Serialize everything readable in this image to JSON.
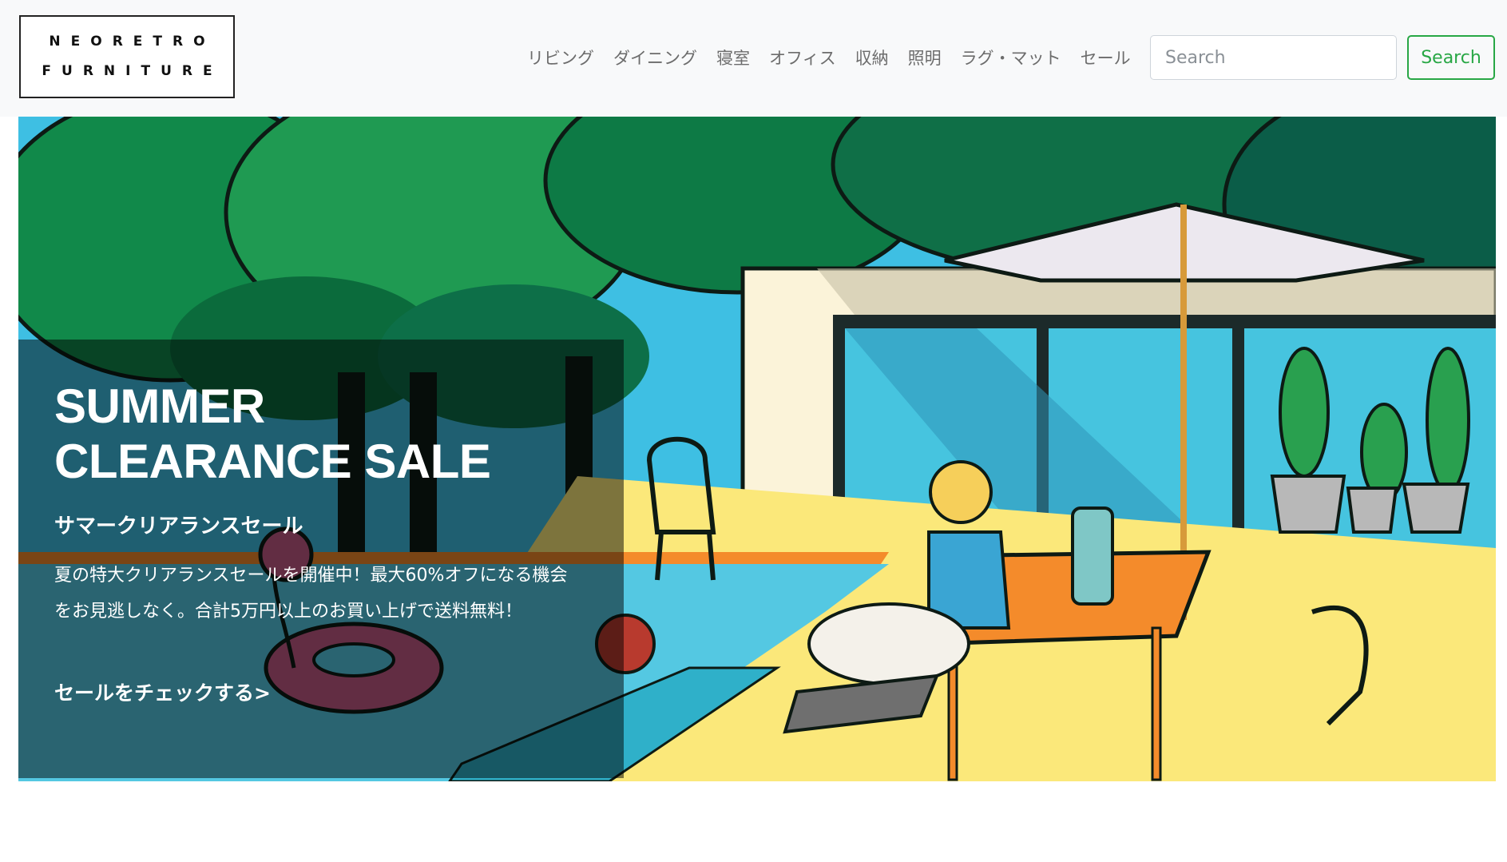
{
  "brand": {
    "line1": "NEORETRO",
    "line2": "FURNITURE"
  },
  "nav": {
    "items": [
      "リビング",
      "ダイニング",
      "寝室",
      "オフィス",
      "収納",
      "照明",
      "ラグ・マット",
      "セール"
    ]
  },
  "search": {
    "placeholder": "Search",
    "button_label": "Search"
  },
  "hero": {
    "title": "SUMMER\nCLEARANCE SALE",
    "subtitle": "サマークリアランスセール",
    "body": "夏の特大クリアランスセールを開催中！最大60%オフになる機会をお見逃しなく。合計5万円以上のお買い上げで送料無料！",
    "cta": "セールをチェックする>"
  },
  "colors": {
    "accent": "#28a745",
    "navbar_bg": "#f8f9fa",
    "nav_text": "#6c6c6c"
  }
}
